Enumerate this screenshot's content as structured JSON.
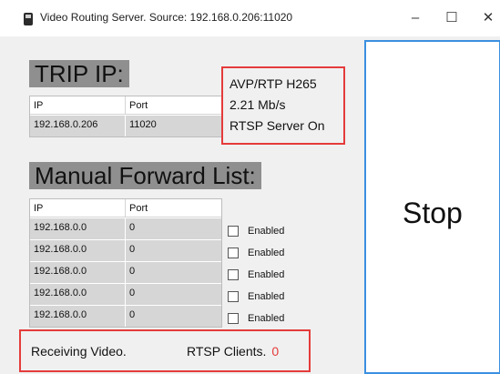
{
  "window": {
    "title": "Video Routing Server. Source: 192.168.0.206:11020",
    "minimize": "–",
    "maximize": "☐",
    "close": "✕"
  },
  "trip": {
    "heading": "TRIP IP:",
    "columns": [
      "IP",
      "Port"
    ],
    "row": {
      "ip": "192.168.0.206",
      "port": "11020"
    }
  },
  "status": {
    "codec": "AVP/RTP H265",
    "bitrate": "2.21 Mb/s",
    "server": "RTSP Server On"
  },
  "forward": {
    "heading": "Manual Forward List:",
    "columns": [
      "IP",
      "Port"
    ],
    "rows": [
      {
        "ip": "192.168.0.0",
        "port": "0",
        "label": "Enabled"
      },
      {
        "ip": "192.168.0.0",
        "port": "0",
        "label": "Enabled"
      },
      {
        "ip": "192.168.0.0",
        "port": "0",
        "label": "Enabled"
      },
      {
        "ip": "192.168.0.0",
        "port": "0",
        "label": "Enabled"
      },
      {
        "ip": "192.168.0.0",
        "port": "0",
        "label": "Enabled"
      }
    ]
  },
  "footer": {
    "receiving": "Receiving Video.",
    "clients_label": "RTSP Clients.",
    "clients_count": "0"
  },
  "stop_button": {
    "label": "Stop"
  },
  "colors": {
    "highlight": "#e53b3b",
    "focus_border": "#3b8fe0",
    "heading_bg": "#8f8f8f"
  }
}
